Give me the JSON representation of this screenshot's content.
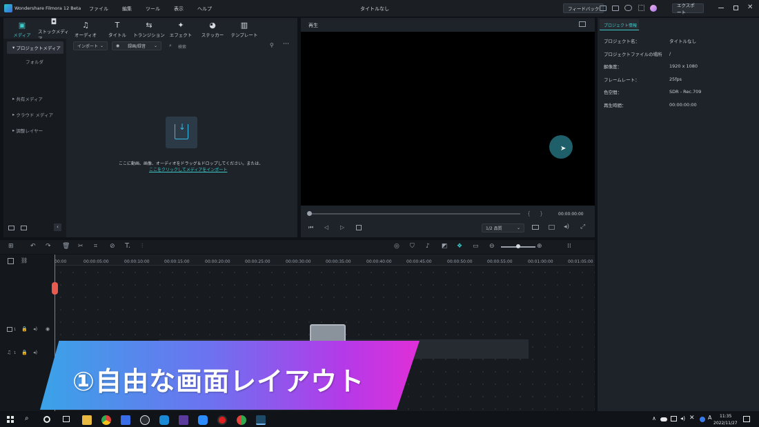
{
  "titlebar": {
    "app_name": "Wondershare Filmora 12 Beta",
    "menus": [
      "ファイル",
      "編集",
      "ツール",
      "表示",
      "ヘルプ"
    ],
    "doc_title": "タイトルなし",
    "feedback_label": "フィードバック",
    "export_label": "エクスポート"
  },
  "media_tabs": [
    {
      "label": "メディア",
      "icon": "media-icon",
      "glyph": "▣",
      "active": true
    },
    {
      "label": "ストックメディア",
      "icon": "stock-media-icon",
      "glyph": "◘",
      "active": false
    },
    {
      "label": "オーディオ",
      "icon": "music-note-icon",
      "glyph": "♫",
      "active": false
    },
    {
      "label": "タイトル",
      "icon": "title-t-icon",
      "glyph": "T",
      "active": false
    },
    {
      "label": "トランジション",
      "icon": "transition-icon",
      "glyph": "⇆",
      "active": false
    },
    {
      "label": "エフェクト",
      "icon": "effects-icon",
      "glyph": "✦",
      "active": false
    },
    {
      "label": "ステッカー",
      "icon": "sticker-icon",
      "glyph": "◕",
      "active": false
    },
    {
      "label": "テンプレート",
      "icon": "template-icon",
      "glyph": "▥",
      "active": false
    }
  ],
  "sidebar": {
    "project_media": "プロジェクトメディア",
    "folder": "フォルダ",
    "shared_media": "共有メディア",
    "cloud_media": "クラウド メディア",
    "adjustment_layer": "調整レイヤー"
  },
  "media_toolbar": {
    "import_label": "インポート",
    "filter_label": "録画/録音",
    "search_placeholder": "検索"
  },
  "import_area": {
    "hint": "ここに動画、画像、オーディオをドラッグ＆ドロップしてください。または、",
    "link": "ここをクリックしてメディアをインポート"
  },
  "preview": {
    "label": "再生",
    "timecode": "00:00:00:00",
    "quality": "1/2 品質"
  },
  "project_info": {
    "tab": "プロジェクト情報",
    "rows": [
      {
        "k": "プロジェクト名：",
        "v": "タイトルなし"
      },
      {
        "k": "プロジェクトファイルの場所",
        "v": "/"
      },
      {
        "k": "解像度：",
        "v": "1920 x 1080"
      },
      {
        "k": "フレームレート：",
        "v": "25fps"
      },
      {
        "k": "色空間：",
        "v": "SDR - Rec.709"
      },
      {
        "k": "再生時間：",
        "v": "00:00:00:00"
      }
    ]
  },
  "timeline": {
    "ruler": [
      "00:00",
      "00:00:05:00",
      "00:00:10:00",
      "00:00:15:00",
      "00:00:20:00",
      "00:00:25:00",
      "00:00:30:00",
      "00:00:35:00",
      "00:00:40:00",
      "00:00:45:00",
      "00:00:50:00",
      "00:00:55:00",
      "00:01:00:00",
      "00:01:05:00"
    ],
    "video_track": "1",
    "audio_track": "1"
  },
  "banner": {
    "text": "①自由な画面レイアウト"
  },
  "taskbar": {
    "time": "11:35",
    "date": "2022/11/27"
  },
  "colors": {
    "accent": "#3ec8c8",
    "playhead": "#e8594f"
  }
}
